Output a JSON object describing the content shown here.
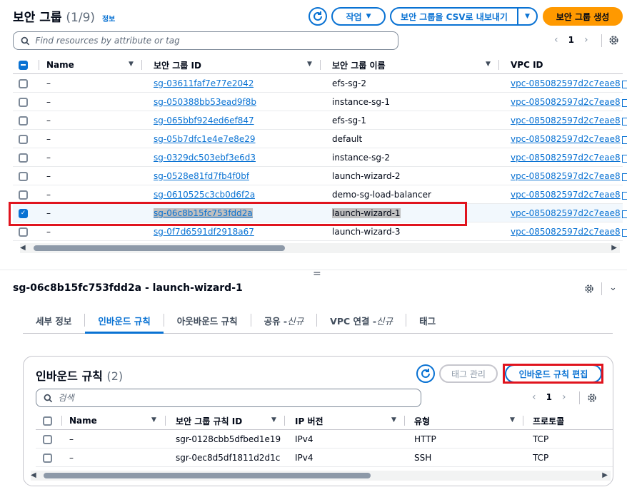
{
  "header": {
    "title": "보안 그룹",
    "count": "(1/9)",
    "info": "정보",
    "actions_label": "작업",
    "export_label": "보안 그룹을 CSV로 내보내기",
    "create_label": "보안 그룹 생성"
  },
  "search": {
    "placeholder": "Find resources by attribute or tag"
  },
  "pager": {
    "page": "1"
  },
  "table": {
    "columns": [
      "Name",
      "보안 그룹 ID",
      "보안 그룹 이름",
      "VPC ID"
    ],
    "rows": [
      {
        "name": "–",
        "id": "sg-03611faf7e77e2042",
        "group_name": "efs-sg-2",
        "vpc": "vpc-085082597d2c7eae8",
        "selected": false
      },
      {
        "name": "–",
        "id": "sg-050388bb53ead9f8b",
        "group_name": "instance-sg-1",
        "vpc": "vpc-085082597d2c7eae8",
        "selected": false
      },
      {
        "name": "–",
        "id": "sg-065bbf924ed6ef847",
        "group_name": "efs-sg-1",
        "vpc": "vpc-085082597d2c7eae8",
        "selected": false
      },
      {
        "name": "–",
        "id": "sg-05b7dfc1e4e7e8e29",
        "group_name": "default",
        "vpc": "vpc-085082597d2c7eae8",
        "selected": false
      },
      {
        "name": "–",
        "id": "sg-0329dc503ebf3e6d3",
        "group_name": "instance-sg-2",
        "vpc": "vpc-085082597d2c7eae8",
        "selected": false
      },
      {
        "name": "–",
        "id": "sg-0528e81fd7fb4f0bf",
        "group_name": "launch-wizard-2",
        "vpc": "vpc-085082597d2c7eae8",
        "selected": false
      },
      {
        "name": "–",
        "id": "sg-0610525c3cb0d6f2a",
        "group_name": "demo-sg-load-balancer",
        "vpc": "vpc-085082597d2c7eae8",
        "selected": false
      },
      {
        "name": "–",
        "id": "sg-06c8b15fc753fdd2a",
        "group_name": "launch-wizard-1",
        "vpc": "vpc-085082597d2c7eae8",
        "selected": true
      },
      {
        "name": "–",
        "id": "sg-0f7d6591df2918a67",
        "group_name": "launch-wizard-3",
        "vpc": "vpc-085082597d2c7eae8",
        "selected": false
      }
    ]
  },
  "detail": {
    "title": "sg-06c8b15fc753fdd2a - launch-wizard-1",
    "tabs": [
      {
        "label": "세부 정보",
        "active": false
      },
      {
        "label": "인바운드 규칙",
        "active": true
      },
      {
        "label": "아웃바운드 규칙",
        "active": false
      },
      {
        "label": "공유 -",
        "suffix": "신규",
        "active": false
      },
      {
        "label": "VPC 연결 -",
        "suffix": "신규",
        "active": false
      },
      {
        "label": "태그",
        "active": false
      }
    ]
  },
  "inbound": {
    "title": "인바운드 규칙",
    "count": "(2)",
    "manage_tags_label": "태그 관리",
    "edit_label": "인바운드 규칙 편집",
    "search_placeholder": "검색",
    "page": "1",
    "columns": [
      "Name",
      "보안 그룹 규칙 ID",
      "IP 버전",
      "유형",
      "프로토콜"
    ],
    "rows": [
      {
        "name": "–",
        "rule_id": "sgr-0128cbb5dfbed1e19",
        "ip_version": "IPv4",
        "type": "HTTP",
        "protocol": "TCP"
      },
      {
        "name": "–",
        "rule_id": "sgr-0ec8d5df1811d2d1c",
        "ip_version": "IPv4",
        "type": "SSH",
        "protocol": "TCP"
      }
    ]
  },
  "colors": {
    "link": "#0972d3",
    "primary": "#ff9900",
    "highlight_box": "#e0141e"
  },
  "icons": [
    "refresh-icon",
    "caret-down-icon",
    "search-icon",
    "chevron-left-icon",
    "chevron-right-icon",
    "settings-icon",
    "external-link-icon",
    "chevron-down-icon"
  ]
}
